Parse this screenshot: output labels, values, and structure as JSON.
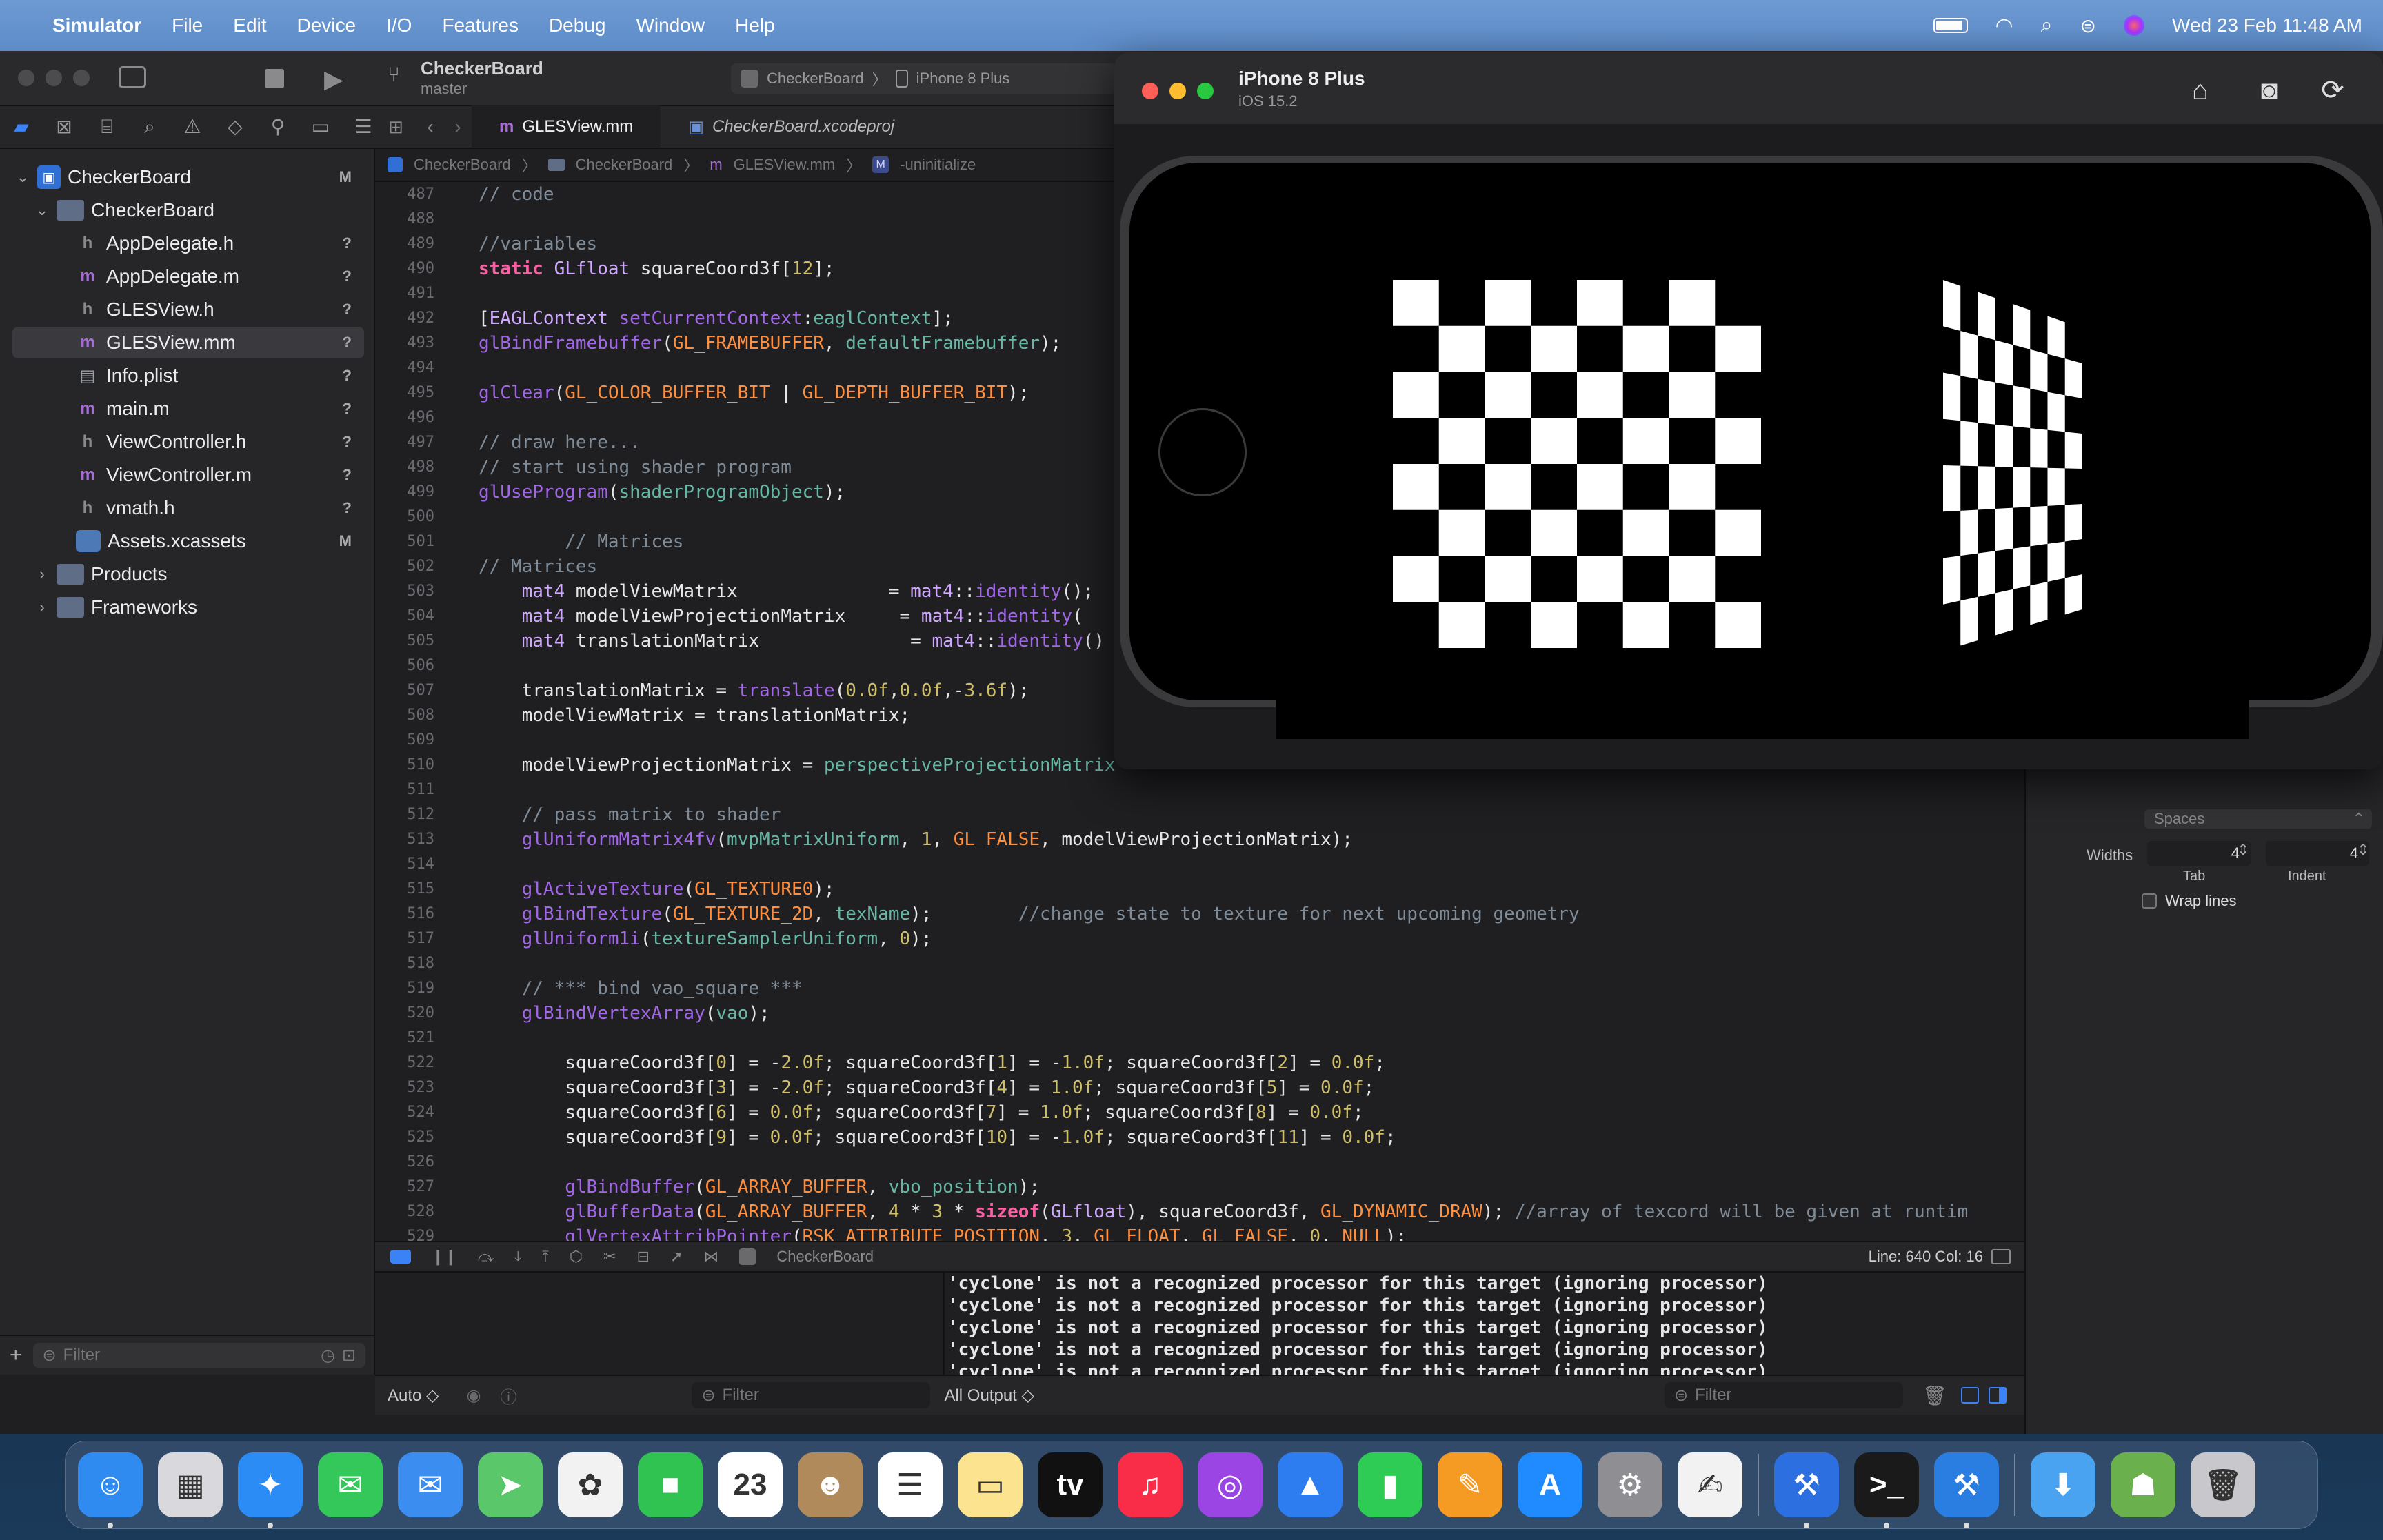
{
  "menubar": {
    "app": "Simulator",
    "items": [
      "File",
      "Edit",
      "Device",
      "I/O",
      "Features",
      "Debug",
      "Window",
      "Help"
    ],
    "clock": "Wed 23 Feb  11:48 AM"
  },
  "toolbar": {
    "project": "CheckerBoard",
    "branch": "master",
    "scheme": "CheckerBoard",
    "destination": "iPhone 8 Plus"
  },
  "tabs": [
    {
      "label": "GLESView.mm",
      "icon": "m"
    },
    {
      "label": "CheckerBoard.xcodeproj",
      "icon": "proj"
    }
  ],
  "jumpbar": [
    "CheckerBoard",
    "CheckerBoard",
    "GLESView.mm",
    "-uninitialize"
  ],
  "navigator": [
    {
      "label": "CheckerBoard",
      "kind": "proj",
      "depth": 0,
      "disclosure": "open",
      "badge": "M"
    },
    {
      "label": "CheckerBoard",
      "kind": "folder",
      "depth": 1,
      "disclosure": "open",
      "badge": ""
    },
    {
      "label": "AppDelegate.h",
      "kind": "h",
      "depth": 2,
      "disclosure": "",
      "badge": "?"
    },
    {
      "label": "AppDelegate.m",
      "kind": "m",
      "depth": 2,
      "disclosure": "",
      "badge": "?"
    },
    {
      "label": "GLESView.h",
      "kind": "h",
      "depth": 2,
      "disclosure": "",
      "badge": "?"
    },
    {
      "label": "GLESView.mm",
      "kind": "m",
      "depth": 2,
      "disclosure": "",
      "badge": "?",
      "selected": true
    },
    {
      "label": "Info.plist",
      "kind": "plist",
      "depth": 2,
      "disclosure": "",
      "badge": "?"
    },
    {
      "label": "main.m",
      "kind": "m",
      "depth": 2,
      "disclosure": "",
      "badge": "?"
    },
    {
      "label": "ViewController.h",
      "kind": "h",
      "depth": 2,
      "disclosure": "",
      "badge": "?"
    },
    {
      "label": "ViewController.m",
      "kind": "m",
      "depth": 2,
      "disclosure": "",
      "badge": "?"
    },
    {
      "label": "vmath.h",
      "kind": "h",
      "depth": 2,
      "disclosure": "",
      "badge": "?"
    },
    {
      "label": "Assets.xcassets",
      "kind": "assets",
      "depth": 2,
      "disclosure": "",
      "badge": "M"
    },
    {
      "label": "Products",
      "kind": "folder",
      "depth": 1,
      "disclosure": "closed",
      "badge": ""
    },
    {
      "label": "Frameworks",
      "kind": "folder",
      "depth": 1,
      "disclosure": "closed",
      "badge": ""
    }
  ],
  "sidebar_filter": "Filter",
  "code": [
    {
      "n": "487",
      "html": "<span class='cm'>// code</span>"
    },
    {
      "n": "488",
      "html": ""
    },
    {
      "n": "489",
      "html": "<span class='cm'>//variables</span>"
    },
    {
      "n": "490",
      "html": "<span class='kw'>static</span> <span class='ty'>GLfloat</span> squareCoord3f[<span class='num'>12</span>];"
    },
    {
      "n": "491",
      "html": ""
    },
    {
      "n": "492",
      "html": "[<span class='ty'>EAGLContext</span> <span class='fn'>setCurrentContext</span>:<span class='var'>eaglContext</span>];"
    },
    {
      "n": "493",
      "html": "<span class='fn'>glBindFramebuffer</span>(<span class='mac'>GL_FRAMEBUFFER</span>, <span class='var'>defaultFramebuffer</span>);"
    },
    {
      "n": "494",
      "html": ""
    },
    {
      "n": "495",
      "html": "<span class='fn'>glClear</span>(<span class='mac'>GL_COLOR_BUFFER_BIT</span> | <span class='mac'>GL_DEPTH_BUFFER_BIT</span>);"
    },
    {
      "n": "496",
      "html": ""
    },
    {
      "n": "497",
      "html": "<span class='cm'>// draw here...</span>"
    },
    {
      "n": "498",
      "html": "<span class='cm'>// start using shader program</span>"
    },
    {
      "n": "499",
      "html": "<span class='fn'>glUseProgram</span>(<span class='var'>shaderProgramObject</span>);"
    },
    {
      "n": "500",
      "html": ""
    },
    {
      "n": "501",
      "html": "        <span class='cm'>// Matrices</span>"
    },
    {
      "n": "502",
      "html": "<span class='cm'>// Matrices</span>"
    },
    {
      "n": "503",
      "html": "    <span class='ty'>mat4</span> modelViewMatrix              = <span class='ty'>mat4</span>::<span class='fn'>identity</span>();"
    },
    {
      "n": "504",
      "html": "    <span class='ty'>mat4</span> modelViewProjectionMatrix     = <span class='ty'>mat4</span>::<span class='fn'>identity</span>("
    },
    {
      "n": "505",
      "html": "    <span class='ty'>mat4</span> translationMatrix              = <span class='ty'>mat4</span>::<span class='fn'>identity</span>()"
    },
    {
      "n": "506",
      "html": ""
    },
    {
      "n": "507",
      "html": "    translationMatrix = <span class='fn'>translate</span>(<span class='num'>0.0f</span>,<span class='num'>0.0f</span>,-<span class='num'>3.6f</span>);"
    },
    {
      "n": "508",
      "html": "    modelViewMatrix = translationMatrix;"
    },
    {
      "n": "509",
      "html": ""
    },
    {
      "n": "510",
      "html": "    modelViewProjectionMatrix = <span class='var'>perspectiveProjectionMatrix</span>"
    },
    {
      "n": "511",
      "html": ""
    },
    {
      "n": "512",
      "html": "    <span class='cm'>// pass matrix to shader</span>"
    },
    {
      "n": "513",
      "html": "    <span class='fn'>glUniformMatrix4fv</span>(<span class='var'>mvpMatrixUniform</span>, <span class='num'>1</span>, <span class='mac'>GL_FALSE</span>, modelViewProjectionMatrix);"
    },
    {
      "n": "514",
      "html": ""
    },
    {
      "n": "515",
      "html": "    <span class='fn'>glActiveTexture</span>(<span class='mac'>GL_TEXTURE0</span>);"
    },
    {
      "n": "516",
      "html": "    <span class='fn'>glBindTexture</span>(<span class='mac'>GL_TEXTURE_2D</span>, <span class='var'>texName</span>);        <span class='cm'>//change state to texture for next upcoming geometry</span>"
    },
    {
      "n": "517",
      "html": "    <span class='fn'>glUniform1i</span>(<span class='var'>textureSamplerUniform</span>, <span class='num'>0</span>);"
    },
    {
      "n": "518",
      "html": ""
    },
    {
      "n": "519",
      "html": "    <span class='cm'>// *** bind vao_square ***</span>"
    },
    {
      "n": "520",
      "html": "    <span class='fn'>glBindVertexArray</span>(<span class='var'>vao</span>);"
    },
    {
      "n": "521",
      "html": ""
    },
    {
      "n": "522",
      "html": "        squareCoord3f[<span class='num'>0</span>] = -<span class='num'>2.0f</span>; squareCoord3f[<span class='num'>1</span>] = -<span class='num'>1.0f</span>; squareCoord3f[<span class='num'>2</span>] = <span class='num'>0.0f</span>;"
    },
    {
      "n": "523",
      "html": "        squareCoord3f[<span class='num'>3</span>] = -<span class='num'>2.0f</span>; squareCoord3f[<span class='num'>4</span>] = <span class='num'>1.0f</span>; squareCoord3f[<span class='num'>5</span>] = <span class='num'>0.0f</span>;"
    },
    {
      "n": "524",
      "html": "        squareCoord3f[<span class='num'>6</span>] = <span class='num'>0.0f</span>; squareCoord3f[<span class='num'>7</span>] = <span class='num'>1.0f</span>; squareCoord3f[<span class='num'>8</span>] = <span class='num'>0.0f</span>;"
    },
    {
      "n": "525",
      "html": "        squareCoord3f[<span class='num'>9</span>] = <span class='num'>0.0f</span>; squareCoord3f[<span class='num'>10</span>] = -<span class='num'>1.0f</span>; squareCoord3f[<span class='num'>11</span>] = <span class='num'>0.0f</span>;"
    },
    {
      "n": "526",
      "html": ""
    },
    {
      "n": "527",
      "html": "        <span class='fn'>glBindBuffer</span>(<span class='mac'>GL_ARRAY_BUFFER</span>, <span class='var'>vbo_position</span>);"
    },
    {
      "n": "528",
      "html": "        <span class='fn'>glBufferData</span>(<span class='mac'>GL_ARRAY_BUFFER</span>, <span class='num'>4</span> * <span class='num'>3</span> * <span class='kw'>sizeof</span>(<span class='ty'>GLfloat</span>), squareCoord3f, <span class='mac'>GL_DYNAMIC_DRAW</span>); <span class='cm'>//array of texcord will be given at runtim</span>"
    },
    {
      "n": "529",
      "html": "        <span class='fn'>glVertexAttribPointer</span>(<span class='mac'>RSK_ATTRIBUTE_POSITION</span>, <span class='num'>3</span>, <span class='mac'>GL_FLOAT</span>, <span class='mac'>GL_FALSE</span>, <span class='num'>0</span>, <span class='mac'>NULL</span>);"
    }
  ],
  "debugbar": {
    "target": "CheckerBoard",
    "line_col": "Line: 640  Col: 16"
  },
  "console_lines": [
    "'cyclone' is not a recognized processor for this target (ignoring processor)",
    "'cyclone' is not a recognized processor for this target (ignoring processor)",
    "'cyclone' is not a recognized processor for this target (ignoring processor)",
    "'cyclone' is not a recognized processor for this target (ignoring processor)",
    "'cyclone' is not a recognized processor for this target (ignoring processor)"
  ],
  "bottombar": {
    "auto_label": "Auto ◇",
    "filter1": "Filter",
    "output_label": "All Output ◇",
    "filter2": "Filter"
  },
  "inspector": {
    "spaces": "Spaces",
    "widths_label": "Widths",
    "tab_value": "4",
    "indent_value": "4",
    "tab_label": "Tab",
    "indent_label": "Indent",
    "wrap_lines": "Wrap lines"
  },
  "simulator": {
    "device": "iPhone 8 Plus",
    "os": "iOS 15.2"
  },
  "dock": [
    {
      "name": "finder",
      "bg": "#2f8bf0",
      "glyph": "☺",
      "dot": true
    },
    {
      "name": "launchpad",
      "bg": "#d9d9dd",
      "glyph": "▦",
      "dot": false
    },
    {
      "name": "safari",
      "bg": "#2c8cf5",
      "glyph": "✦",
      "dot": true
    },
    {
      "name": "messages",
      "bg": "#34c759",
      "glyph": "✉",
      "dot": false
    },
    {
      "name": "mail",
      "bg": "#3b8ef0",
      "glyph": "✉",
      "dot": false
    },
    {
      "name": "maps",
      "bg": "#5ac86a",
      "glyph": "➤",
      "dot": false
    },
    {
      "name": "photos",
      "bg": "#f2f2f2",
      "glyph": "✿",
      "dot": false
    },
    {
      "name": "facetime",
      "bg": "#30c352",
      "glyph": "■",
      "dot": false
    },
    {
      "name": "calendar",
      "bg": "#ffffff",
      "glyph": "23",
      "dot": false
    },
    {
      "name": "contacts",
      "bg": "#b08a5a",
      "glyph": "☻",
      "dot": false
    },
    {
      "name": "reminders",
      "bg": "#ffffff",
      "glyph": "☰",
      "dot": false
    },
    {
      "name": "notes",
      "bg": "#fbe38f",
      "glyph": "▭",
      "dot": false
    },
    {
      "name": "tv",
      "bg": "#111111",
      "glyph": "tv",
      "dot": false
    },
    {
      "name": "music",
      "bg": "#fa2d48",
      "glyph": "♫",
      "dot": false
    },
    {
      "name": "podcasts",
      "bg": "#9b45e4",
      "glyph": "◎",
      "dot": false
    },
    {
      "name": "keynote",
      "bg": "#2d7cf0",
      "glyph": "▲",
      "dot": false
    },
    {
      "name": "numbers",
      "bg": "#2ecc55",
      "glyph": "▮",
      "dot": false
    },
    {
      "name": "pages",
      "bg": "#f59b23",
      "glyph": "✎",
      "dot": false
    },
    {
      "name": "app-store",
      "bg": "#1f8bff",
      "glyph": "A",
      "dot": false
    },
    {
      "name": "system-preferences",
      "bg": "#8e8e93",
      "glyph": "⚙",
      "dot": false
    },
    {
      "name": "textedit",
      "bg": "#f2f2f2",
      "glyph": "✍",
      "dot": false
    },
    {
      "sep": true
    },
    {
      "name": "xcode-instruments",
      "bg": "#2c6fe0",
      "glyph": "⚒",
      "dot": true
    },
    {
      "name": "terminal",
      "bg": "#1a1a1a",
      "glyph": ">_",
      "dot": true
    },
    {
      "name": "xcode",
      "bg": "#2a7de1",
      "glyph": "⚒",
      "dot": true
    },
    {
      "sep": true
    },
    {
      "name": "downloads",
      "bg": "#4aa3f0",
      "glyph": "⬇",
      "dot": false
    },
    {
      "name": "android",
      "bg": "#6ab04c",
      "glyph": "☗",
      "dot": false
    },
    {
      "name": "trash",
      "bg": "#c8c8cc",
      "glyph": "🗑",
      "dot": false
    }
  ],
  "colors": {
    "menubar": "#6e9ad2",
    "editor_bg": "#1f1f22",
    "keyword": "#fc5fa3",
    "comment": "#7f8c98",
    "function": "#a167e6",
    "macro": "#fd8f3f",
    "number": "#d0bf69"
  }
}
